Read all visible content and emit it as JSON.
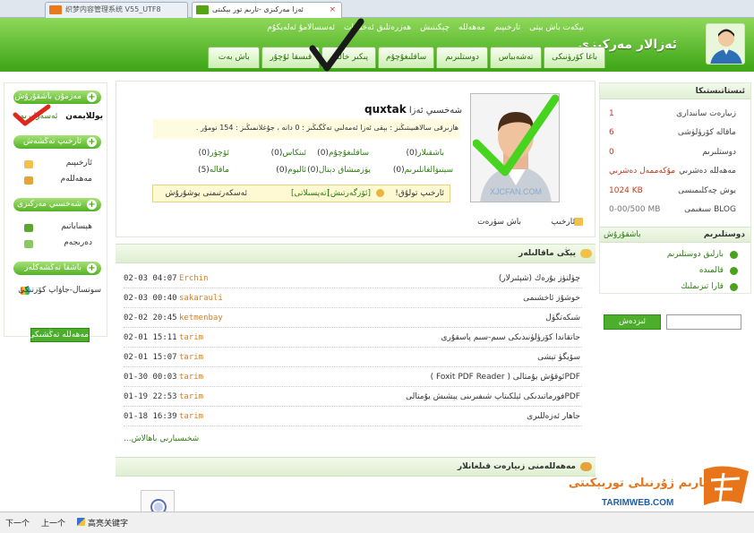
{
  "browser": {
    "tabs": [
      {
        "title": "织梦内容管理系统 V55_UTF8",
        "active": false
      },
      {
        "title": "ئەزا مەركىزى -تارىم تور بېكىتى",
        "active": true
      }
    ],
    "close_glyph": "×"
  },
  "header": {
    "title": "ئەزالار مەركىزى",
    "subnav": [
      "ئەسسالامۇ ئەلەيكۇم",
      "ھەزرەتلىق ئەخبارات",
      "چېكىنىش",
      "مەھەللە",
      "تارخىپىم",
      "بېكەت باش بېتى"
    ],
    "mainnav": [
      "باش بەت",
      "قىسقا ئۇچۇر",
      "پىكىر خالتام",
      "ساقلىغۇچۇم",
      "دوستلىرىم",
      "تەشەبباس",
      "باغا كۆرۈنىكى"
    ]
  },
  "left": {
    "sections": [
      {
        "title": "مەزمۇن باشقۇرۇش",
        "items": [
          "ئەسەرلىرىم",
          "يوللايمەن"
        ]
      },
      {
        "title": "ئارخىپ تەڭشەش",
        "items": [
          "ئارخىپىم",
          "مەھەللەم"
        ]
      },
      {
        "title": "شەخسىي مەركىزى",
        "items": [
          "ھېساباتىم",
          "دەرىجەم"
        ]
      },
      {
        "title": "باشقا تەڭشەكلەر",
        "items": [
          "سوتسال-جاۋاپ كۆزنىكى"
        ]
      }
    ],
    "button": "مەھەللە تەڭشىكى"
  },
  "profile": {
    "username": "quxtak",
    "username_suffix": "شەخسىي ئەزا",
    "summary": "ھازىرقى سالاھىيىتىڭىز : بېقى ئەزا ئەمەلىي تەڭگىڭىز : 0 دانە ، جۇغلانمىڭىز : 154 نومۇر .",
    "stats": [
      {
        "label": "باشقىلار",
        "value": "(0)"
      },
      {
        "label": "ساقلىغۇچۇم",
        "value": "(0)"
      },
      {
        "label": "ئىنكاس",
        "value": "(0)"
      },
      {
        "label": "ئۆچۈر",
        "value": "(0)"
      },
      {
        "label": "سېتىۋالغانلىرىم",
        "value": "(0)"
      },
      {
        "label": "يۈزمىشاق دېتال",
        "value": "(0)"
      },
      {
        "label": "ئالبوم",
        "value": "(0)"
      },
      {
        "label": "ماقالە",
        "value": "(5)"
      }
    ],
    "info_prefix": "ئارخىپ تولۇق!",
    "info_links": [
      "[ئۆزگەرتىش]",
      "[تەپسىلاتى]"
    ],
    "info_suffix": "ئەسكەرتىمنى يوشۇرۇش",
    "photo_watermark": "XJCFAN.COM",
    "photo_actions": [
      "ئارخىپ",
      "باش سۈرەت"
    ]
  },
  "articles": {
    "title": "يېڭى ماقالىلەر",
    "rows": [
      {
        "title": "چۈلتۈز يۇرەك (شېئىرلار)",
        "user": "Erchin",
        "date": "02-03 04:07"
      },
      {
        "title": "خوشۇز ئاخشىمى",
        "user": "sakarauli",
        "date": "02-03 00:40"
      },
      {
        "title": "شىكەتگۈل",
        "user": "ketmenbay",
        "date": "02-02 20:45"
      },
      {
        "title": "جاتقاندا كۆرۈلۈنىدىكى سىم-سىم پاسقۇرى",
        "user": "tarim",
        "date": "02-01 15:11"
      },
      {
        "title": "سۆيگۈ تېشى",
        "user": "tarim",
        "date": "02-01 15:07"
      },
      {
        "title": "PDFئوقۇش يۇمتالى ( Foxit PDF Reader )",
        "user": "tarim",
        "date": "01-30 00:03"
      },
      {
        "title": "PDFفورماتىدىكى ئېلكىتاپ شىفىرىنى يېشىش يۇمتالى",
        "user": "tarim",
        "date": "01-19 22:53"
      },
      {
        "title": "جاھار ئەزەللىرى",
        "user": "tarim",
        "date": "01-18 16:39"
      }
    ],
    "more": "شخىسبارىي باھالاش..."
  },
  "visitors": {
    "title": "مەھەللەمنى زىيارەت قىلغانلار"
  },
  "right": {
    "stats_title": "ئىستاتىستىكا",
    "stats": [
      {
        "label": "زىيارەت سانىدارى",
        "value": "1"
      },
      {
        "label": "ماقالە كۆرۈلۈشى",
        "value": "6"
      },
      {
        "label": "دوستلىرىم",
        "value": "0"
      },
      {
        "label": "مەھەللە دەشرىي",
        "value": "مۇكەممەل دەشرىي"
      },
      {
        "label": "بوش چەكلىمىسى",
        "value": "1024 KB"
      },
      {
        "label": "BLOG سىغىمى",
        "value": "0-00/500 MB"
      }
    ],
    "friends_title": "دوستلىرىم",
    "friends_manage": "باشقۇرۇش",
    "friends_links": [
      "بارلىق دوستلىرىم",
      "قالمىدە",
      "قارا تىزىملىك"
    ],
    "search_button": "ئىزدەش",
    "search_value": ""
  },
  "logo": {
    "text": "تارىم ژۇرنىلى توربېكىتى",
    "url": "TARIMWEB.COM"
  },
  "findbar": {
    "next": "下一个",
    "prev": "上一个",
    "highlight": "高亮关键字"
  },
  "colors": {
    "header_green": "#3da616",
    "link_green": "#2d7d10",
    "stat_red": "#c0391b",
    "username_orange": "#d5802a"
  }
}
